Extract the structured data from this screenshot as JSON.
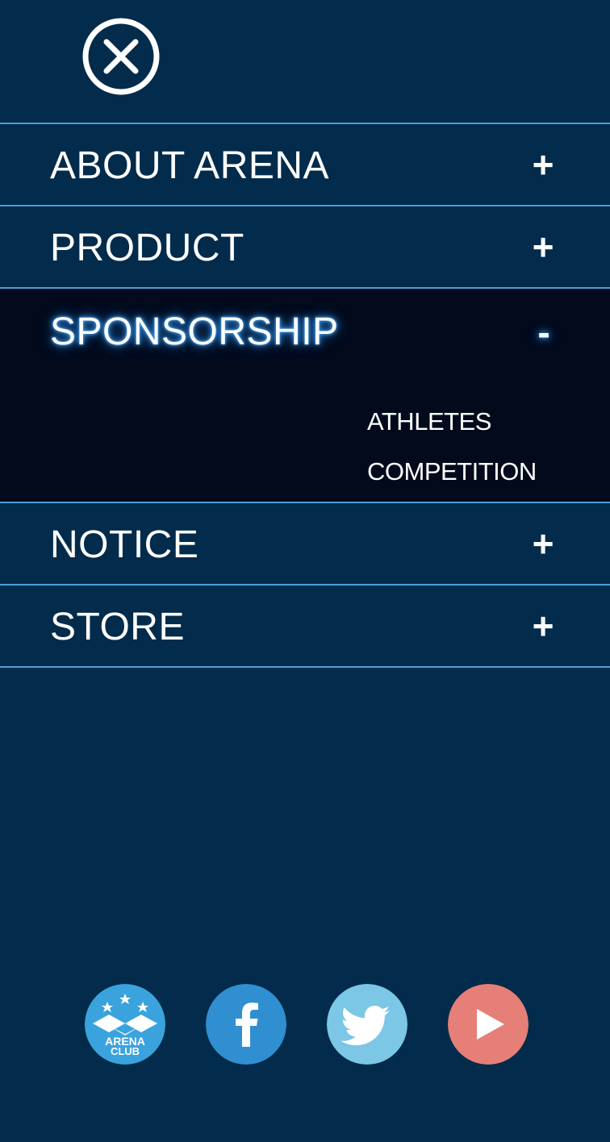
{
  "close": {
    "icon": "close-circle-icon",
    "color": "#ffffff"
  },
  "menu": {
    "items": [
      {
        "label": "ABOUT ARENA",
        "toggle": "+",
        "expanded": false
      },
      {
        "label": "PRODUCT",
        "toggle": "+",
        "expanded": false
      },
      {
        "label": "SPONSORSHIP",
        "toggle": "-",
        "expanded": true,
        "subitems": [
          {
            "label": "ATHLETES"
          },
          {
            "label": "COMPETITION"
          }
        ]
      },
      {
        "label": "NOTICE",
        "toggle": "+",
        "expanded": false
      },
      {
        "label": "STORE",
        "toggle": "+",
        "expanded": false
      }
    ]
  },
  "social": {
    "arena_club": {
      "icon": "arena-club-icon",
      "logo_text_line1": "ARENA",
      "logo_text_line2": "CLUB",
      "color": "#3aa3dd"
    },
    "facebook": {
      "icon": "facebook-icon",
      "color": "#2f8fd0"
    },
    "twitter": {
      "icon": "twitter-icon",
      "color": "#7cc6e6"
    },
    "youtube": {
      "icon": "youtube-play-icon",
      "color": "#e57f78"
    }
  },
  "colors": {
    "background": "#032b4b",
    "divider": "#4a9fd8",
    "expanded_background": "#020a1c",
    "text": "#ffffff"
  }
}
